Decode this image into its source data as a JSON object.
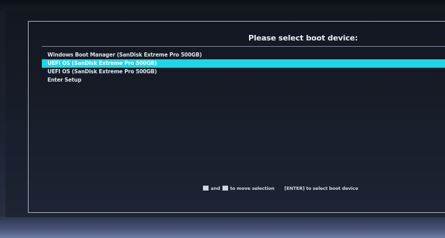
{
  "boot_menu": {
    "title": "Please select boot device:",
    "items": [
      {
        "label": "Windows Boot Manager (SanDisk Extreme Pro 500GB)",
        "selected": false
      },
      {
        "label": "UEFI OS (SanDisk Extreme Pro 500GB)",
        "selected": true
      },
      {
        "label": "UEFI OS (SanDisk Extreme Pro 500GB)",
        "selected": false
      },
      {
        "label": "Enter Setup",
        "selected": false
      }
    ],
    "hint": {
      "and": "and",
      "move": "to move selection",
      "enter": "[ENTER] to select boot device"
    }
  },
  "colors": {
    "background": "#171d29",
    "text": "#dfe5ee",
    "highlight": "#1fd6e8"
  },
  "icons": {
    "up_key": "up-arrow-key-icon",
    "down_key": "down-arrow-key-icon"
  }
}
